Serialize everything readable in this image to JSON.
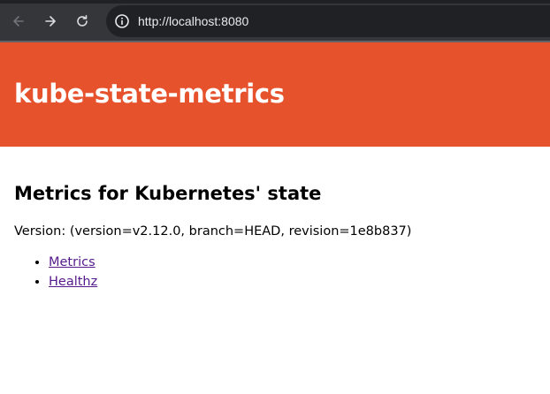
{
  "browser": {
    "url": "http://localhost:8080",
    "icons": {
      "back": "arrow-left-icon",
      "forward": "arrow-right-icon",
      "reload": "reload-icon",
      "site_info": "info-icon"
    },
    "colors": {
      "toolbar": "#35363a",
      "omnibox": "#202124",
      "text": "#e8eaed"
    }
  },
  "header": {
    "title": "kube-state-metrics",
    "background": "#e6522c"
  },
  "main": {
    "heading": "Metrics for Kubernetes' state",
    "version_text": "Version: (version=v2.12.0, branch=HEAD, revision=1e8b837)",
    "links": [
      {
        "label": "Metrics"
      },
      {
        "label": "Healthz"
      }
    ],
    "link_color": "#551a8b"
  }
}
